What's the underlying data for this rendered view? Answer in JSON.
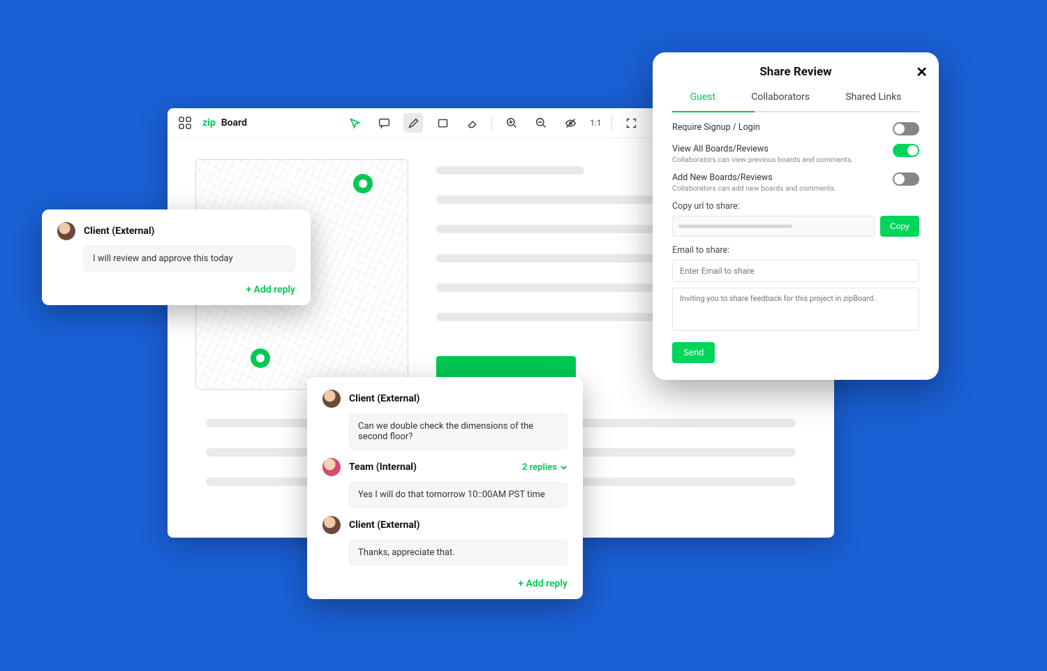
{
  "app": {
    "name_prefix": "zip",
    "name_suffix": "Board"
  },
  "toolbar": {
    "pointer": "pointer",
    "comment": "comment",
    "pencil": "pencil",
    "rect": "rectangle",
    "erase": "erase",
    "zoom_in": "zoom-in",
    "zoom_out": "zoom-out",
    "eye_off": "eye-off",
    "ratio": "1:1",
    "fullscreen": "fullscreen"
  },
  "comments_small": {
    "author": "Client (External)",
    "text": "I will review and approve this today",
    "add_reply": "+ Add reply"
  },
  "comments_big": {
    "t1_author": "Client (External)",
    "t1_text": "Can we double check the dimensions of the second floor?",
    "t2_author": "Team (Internal)",
    "t2_replies": "2 replies",
    "t2_text": "Yes I will do that tomorrow  10::00AM PST time",
    "t3_author": "Client (External)",
    "t3_text": "Thanks, appreciate that.",
    "add_reply": "+ Add reply"
  },
  "share": {
    "title": "Share Review",
    "tabs": {
      "guest": "Guest",
      "collab": "Collaborators",
      "links": "Shared Links"
    },
    "require_signup": "Require Signup / Login",
    "view_all": "View All Boards/Reviews",
    "view_all_sub": "Collaborators can view previous boards and comments.",
    "add_new": "Add New Boards/Reviews",
    "add_new_sub": "Collaborators can add new boards and comments.",
    "copy_label": "Copy url to share:",
    "copy_btn": "Copy",
    "email_label": "Email to share:",
    "email_placeholder": "Enter Email to share",
    "message_placeholder": "Inviting you to share feedback for this project in zipBoard.",
    "send": "Send"
  }
}
